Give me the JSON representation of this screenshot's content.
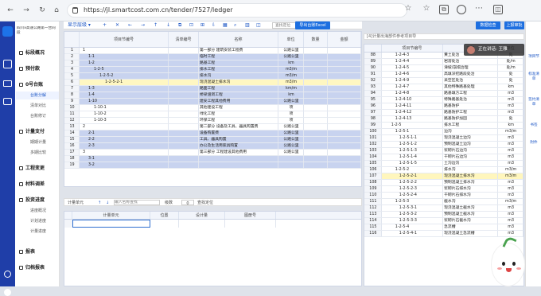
{
  "browser": {
    "url": "https://jl.smartcost.com.cn/tender/7527/ledger"
  },
  "left_nav": {
    "project_name": "四川x高速公路第一合同段",
    "items": [
      {
        "label": "标段概况"
      },
      {
        "label": "预付款"
      },
      {
        "label": "0号台账"
      },
      {
        "label": "台账分解"
      },
      {
        "label": "清单对比"
      },
      {
        "label": "台账修订"
      },
      {
        "label": "计量支付"
      },
      {
        "label": "期期计量"
      },
      {
        "label": "多期比较"
      },
      {
        "label": "工程变更"
      },
      {
        "label": "材料调差"
      },
      {
        "label": "投资进度"
      },
      {
        "label": "进度概况"
      },
      {
        "label": "计划进度"
      },
      {
        "label": "计量进度"
      },
      {
        "label": "报表"
      },
      {
        "label": "归档报表"
      }
    ]
  },
  "toolbar": {
    "display_layers": "显示层级",
    "search_placeholder": "查找定位",
    "export_excel": "导出台账Excel",
    "data_check": "数据检查",
    "upload_design": "上报审批"
  },
  "main_grid": {
    "headers": [
      "项目节编号",
      "清单编号",
      "名称",
      "单位",
      "数量",
      "金额"
    ],
    "rows": [
      {
        "no": "1",
        "code": "1",
        "list": "",
        "name": "第一部分 建筑安装工程费",
        "unit": "公路公里",
        "qty": "",
        "amount": "",
        "style": "normal"
      },
      {
        "no": "2",
        "code": "1-1",
        "list": "",
        "name": "临时工程",
        "unit": "公路公里",
        "qty": "",
        "amount": "",
        "style": "sel"
      },
      {
        "no": "3",
        "code": "1-2",
        "list": "",
        "name": "路基工程",
        "unit": "km",
        "qty": "",
        "amount": "",
        "style": "sel"
      },
      {
        "no": "4",
        "code": "1-2-5",
        "list": "",
        "name": "排水工程",
        "unit": "m3/m",
        "qty": "",
        "amount": "",
        "style": "sel"
      },
      {
        "no": "5",
        "code": "1-2-5-2",
        "list": "",
        "name": "排水沟",
        "unit": "m3/m",
        "qty": "",
        "amount": "",
        "style": "sel"
      },
      {
        "no": "6",
        "code": "1-2-5-2-1",
        "list": "",
        "name": "现浇混凝土排水沟",
        "unit": "m3/m",
        "qty": "",
        "amount": "",
        "style": "cur"
      },
      {
        "no": "7",
        "code": "1-3",
        "list": "",
        "name": "路面工程",
        "unit": "km/m",
        "qty": "",
        "amount": "",
        "style": "sel"
      },
      {
        "no": "8",
        "code": "1-4",
        "list": "",
        "name": "桥梁涵洞工程",
        "unit": "km",
        "qty": "",
        "amount": "",
        "style": "sel"
      },
      {
        "no": "9",
        "code": "1-10",
        "list": "",
        "name": "建安工程其他费用",
        "unit": "公路公里",
        "qty": "",
        "amount": "",
        "style": "sel"
      },
      {
        "no": "10",
        "code": "1-10-1",
        "list": "",
        "name": "其他建设工程",
        "unit": "项",
        "qty": "",
        "amount": "",
        "style": "normal"
      },
      {
        "no": "11",
        "code": "1-10-2",
        "list": "",
        "name": "绿化工程",
        "unit": "项",
        "qty": "",
        "amount": "",
        "style": "normal"
      },
      {
        "no": "12",
        "code": "1-10-3",
        "list": "",
        "name": "环保工程",
        "unit": "项",
        "qty": "",
        "amount": "",
        "style": "normal"
      },
      {
        "no": "13",
        "code": "2",
        "list": "",
        "name": "第二部分 设备及工具、器具购置费",
        "unit": "公路公里",
        "qty": "",
        "amount": "",
        "style": "normal"
      },
      {
        "no": "14",
        "code": "2-1",
        "list": "",
        "name": "设备购置费",
        "unit": "公路公里",
        "qty": "",
        "amount": "",
        "style": "sel"
      },
      {
        "no": "15",
        "code": "2-2",
        "list": "",
        "name": "工具、器具购置",
        "unit": "公路公里",
        "qty": "",
        "amount": "",
        "style": "sel"
      },
      {
        "no": "16",
        "code": "2-3",
        "list": "",
        "name": "办公及生活用家具购置",
        "unit": "公路公里",
        "qty": "",
        "amount": "",
        "style": "sel"
      },
      {
        "no": "17",
        "code": "3",
        "list": "",
        "name": "第三部分 工程建设其他费用",
        "unit": "公路公里",
        "qty": "",
        "amount": "",
        "style": "normal"
      },
      {
        "no": "18",
        "code": "3-1",
        "list": "",
        "name": "",
        "unit": "",
        "qty": "",
        "amount": "",
        "style": "sel"
      },
      {
        "no": "19",
        "code": "3-2",
        "list": "",
        "name": "",
        "unit": "",
        "qty": "",
        "amount": "",
        "style": "sel"
      }
    ]
  },
  "bottom_panel": {
    "measure_unit": "计量单元",
    "search_placeholder": "输入名称查找",
    "zoom_label": "级数",
    "zoom_value": "0",
    "search_btn": "查找定位",
    "headers": [
      "计量单元",
      "位置",
      "设计量",
      "图册号"
    ]
  },
  "right_panel": {
    "toolbar_text": "[4]计量出海部件参考项目导",
    "popup_text": "正在讲话: 王雅",
    "headers": [
      "项目节编号",
      "名称",
      "单位"
    ],
    "rows": [
      {
        "no": "88",
        "code": "1-2-4-3",
        "name": "黄土处治",
        "unit": "处"
      },
      {
        "no": "89",
        "code": "1-2-4-4",
        "name": "岩溶处治",
        "unit": "处/m"
      },
      {
        "no": "90",
        "code": "1-2-4-5",
        "name": "滑坡/崩塌治理",
        "unit": "处/m"
      },
      {
        "no": "91",
        "code": "1-2-4-6",
        "name": "高填深挖路段处治",
        "unit": "处"
      },
      {
        "no": "92",
        "code": "1-2-4-9",
        "name": "采空区处治",
        "unit": "处"
      },
      {
        "no": "93",
        "code": "1-2-4-7",
        "name": "其他特殊路基处理",
        "unit": "km"
      },
      {
        "no": "94",
        "code": "1-2-4-8",
        "name": "路基填方工程",
        "unit": "m3"
      },
      {
        "no": "95",
        "code": "1-2-4-10",
        "name": "特殊路基处治",
        "unit": "m3"
      },
      {
        "no": "96",
        "code": "1-2-4-11",
        "name": "路基防护",
        "unit": "m3"
      },
      {
        "no": "97",
        "code": "1-2-4-12",
        "name": "路基防护工程",
        "unit": "m3"
      },
      {
        "no": "98",
        "code": "1-2-4-13",
        "name": "路基防护加固",
        "unit": "处"
      },
      {
        "no": "99",
        "code": "1-2-5",
        "name": "排水工程",
        "unit": "km"
      },
      {
        "no": "100",
        "code": "1-2-5-1",
        "name": "边沟",
        "unit": "m3/m"
      },
      {
        "no": "101",
        "code": "1-2-5-1-1",
        "name": "现浇混凝土边沟",
        "unit": "m3"
      },
      {
        "no": "102",
        "code": "1-2-5-1-2",
        "name": "预制混凝土边沟",
        "unit": "m3"
      },
      {
        "no": "103",
        "code": "1-2-5-1-3",
        "name": "浆砌片石边沟",
        "unit": "m3"
      },
      {
        "no": "104",
        "code": "1-2-5-1-4",
        "name": "干砌片石边沟",
        "unit": "m3"
      },
      {
        "no": "105",
        "code": "1-2-5-1-5",
        "name": "土沟边沟",
        "unit": "m3"
      },
      {
        "no": "106",
        "code": "1-2-5-2",
        "name": "排水沟",
        "unit": "m3/m"
      },
      {
        "no": "107",
        "code": "1-2-5-2-1",
        "name": "现浇混凝土排水沟",
        "unit": "m3/m",
        "hl": true
      },
      {
        "no": "108",
        "code": "1-2-5-2-2",
        "name": "预制混凝土排水沟",
        "unit": "m3"
      },
      {
        "no": "109",
        "code": "1-2-5-2-3",
        "name": "浆砌片石排水沟",
        "unit": "m3"
      },
      {
        "no": "110",
        "code": "1-2-5-2-4",
        "name": "干砌片石排水沟",
        "unit": "m3"
      },
      {
        "no": "111",
        "code": "1-2-5-3",
        "name": "截水沟",
        "unit": "m3/m"
      },
      {
        "no": "112",
        "code": "1-2-5-3-1",
        "name": "现浇混凝土截水沟",
        "unit": "m3"
      },
      {
        "no": "113",
        "code": "1-2-5-3-2",
        "name": "预制混凝土截水沟",
        "unit": "m3"
      },
      {
        "no": "114",
        "code": "1-2-5-3-3",
        "name": "浆砌片石截水沟",
        "unit": "m3"
      },
      {
        "no": "115",
        "code": "1-2-5-4",
        "name": "急流槽",
        "unit": "m3"
      },
      {
        "no": "116",
        "code": "1-2-5-4-1",
        "name": "现浇混凝土急流槽",
        "unit": "m3"
      }
    ]
  },
  "right_rail": {
    "items": [
      "项目节",
      "标准清单",
      "签约清单",
      "书签",
      "附件"
    ]
  }
}
